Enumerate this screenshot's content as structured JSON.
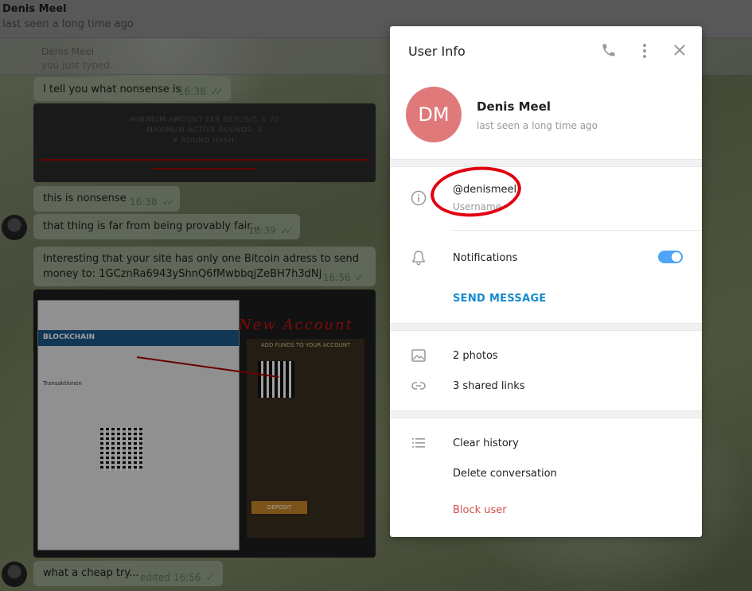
{
  "chat": {
    "name": "Denis Meel",
    "status": "last seen a long time ago",
    "pinned_line1": "Denis Meel",
    "pinned_line2": "you just typed."
  },
  "messages": [
    {
      "text": "I tell you what nonsense is",
      "time": "16:38"
    },
    {
      "text": "this is nonsense",
      "time": "16:38"
    },
    {
      "text": "that thing is far from being provably fair...",
      "time": "16:39"
    },
    {
      "text": "Interesting that your site has only one Bitcoin adress to send money to: 1GCznRa6943yShnQ6fMwbbqjZeBH7h3dNj",
      "time": "16:56"
    },
    {
      "text": "what a cheap try...",
      "time": "edited 16:56"
    }
  ],
  "image1": {
    "line1": "MINIMUM AMOUNT PER DEPOSIT: $ 70",
    "line2": "MAXIMUM ACTIVE ROUNDS: 3",
    "line3": "# ROUND HASH:"
  },
  "image2": {
    "annotation": "New Account",
    "brand": "BLOCKCHAIN",
    "add_funds": "ADD FUNDS TO YOUR ACCOUNT",
    "transactions": "Transaktionen",
    "deposit": "DEPOSIT"
  },
  "panel": {
    "title": "User Info",
    "initials": "DM",
    "name": "Denis Meel",
    "status": "last seen a long time ago",
    "username": "@denismeel",
    "username_label": "Username",
    "notifications_label": "Notifications",
    "notifications_on": true,
    "send_message": "SEND MESSAGE",
    "photos": "2 photos",
    "links": "3 shared links",
    "clear_history": "Clear history",
    "delete_conversation": "Delete conversation",
    "block_user": "Block user"
  },
  "colors": {
    "avatar": "#e07a7a",
    "link": "#168acd",
    "danger": "#d14e4e",
    "toggle": "#4ea4f6",
    "annotation_red": "#e00010"
  }
}
